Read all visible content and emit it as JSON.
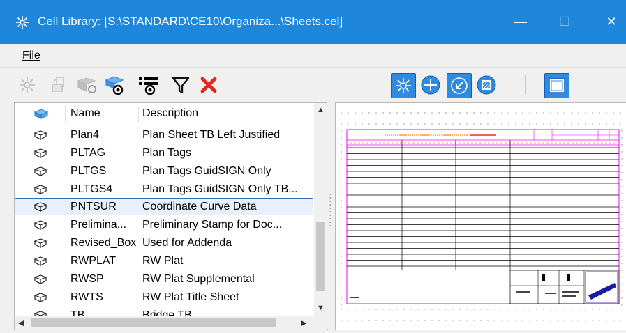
{
  "window": {
    "title": "Cell Library: [S:\\STANDARD\\CE10\\Organiza...\\Sheets.cel]",
    "minimize_glyph": "—",
    "maximize_glyph": "☐",
    "close_glyph": "✕"
  },
  "menu": {
    "file_label": "File"
  },
  "toolbar": {
    "left_icons": [
      "place-cell-icon",
      "create-cell-icon",
      "share-cell-icon",
      "show-display-icon",
      "display-options-icon",
      "filter-icon",
      "delete-icon"
    ],
    "right_icons": [
      "active-placement-icon",
      "active-point-icon",
      "active-terminator-icon",
      "active-pattern-icon",
      "preview-panel-icon"
    ],
    "accent": "#2e8be0",
    "delete_color": "#e0281e"
  },
  "list": {
    "columns": {
      "icon": "",
      "name": "Name",
      "description": "Description"
    },
    "rows": [
      {
        "name": "Plan4",
        "description": "Plan Sheet TB Left Justified"
      },
      {
        "name": "PLTAG",
        "description": "Plan Tags"
      },
      {
        "name": "PLTGS",
        "description": "Plan Tags GuidSIGN Only"
      },
      {
        "name": "PLTGS4",
        "description": "Plan Tags GuidSIGN Only TB..."
      },
      {
        "name": "PNTSUR",
        "description": "Coordinate Curve Data",
        "selected": true
      },
      {
        "name": "Prelimina...",
        "description": "Preliminary Stamp for Doc..."
      },
      {
        "name": "Revised_Box",
        "description": "Used for Addenda"
      },
      {
        "name": "RWPLAT",
        "description": "RW Plat"
      },
      {
        "name": "RWSP",
        "description": "RW Plat Supplemental"
      },
      {
        "name": "RWTS",
        "description": "RW Plat Title Sheet"
      },
      {
        "name": "TB",
        "description": "Bridge TB"
      }
    ]
  },
  "preview": {
    "border_color": "#ff00ff",
    "stamp_color": "#1a1aa8"
  }
}
